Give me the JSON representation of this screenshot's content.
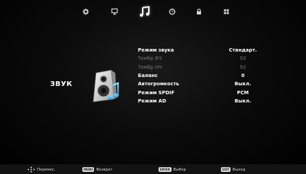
{
  "tabs": [
    {
      "icon": "gear-icon"
    },
    {
      "icon": "monitor-icon"
    },
    {
      "icon": "music-note-icon",
      "active": true
    },
    {
      "icon": "clock-icon"
    },
    {
      "icon": "lock-icon"
    },
    {
      "icon": "grid-icon"
    }
  ],
  "section": {
    "title": "ЗВУК",
    "icon": "speaker-icon"
  },
  "menu": {
    "items": [
      {
        "label": "Режим звука",
        "value": "Стандарт."
      },
      {
        "label": "Тембр ВЧ",
        "value": "50"
      },
      {
        "label": "Тембр НЧ",
        "value": "50"
      },
      {
        "label": "Баланс",
        "value": "0"
      },
      {
        "label": "Автогромкость",
        "value": "Выкл."
      },
      {
        "label": "Режим SPDIF",
        "value": "PCM"
      },
      {
        "label": "Режим AD",
        "value": "Выкл."
      }
    ]
  },
  "help": {
    "move": {
      "label": "Перемес."
    },
    "back": {
      "key": "MENU",
      "label": "Возврат"
    },
    "select": {
      "key": "ENTER",
      "label": "Выбор"
    },
    "exit": {
      "key": "EXIT",
      "label": "Выход"
    }
  }
}
